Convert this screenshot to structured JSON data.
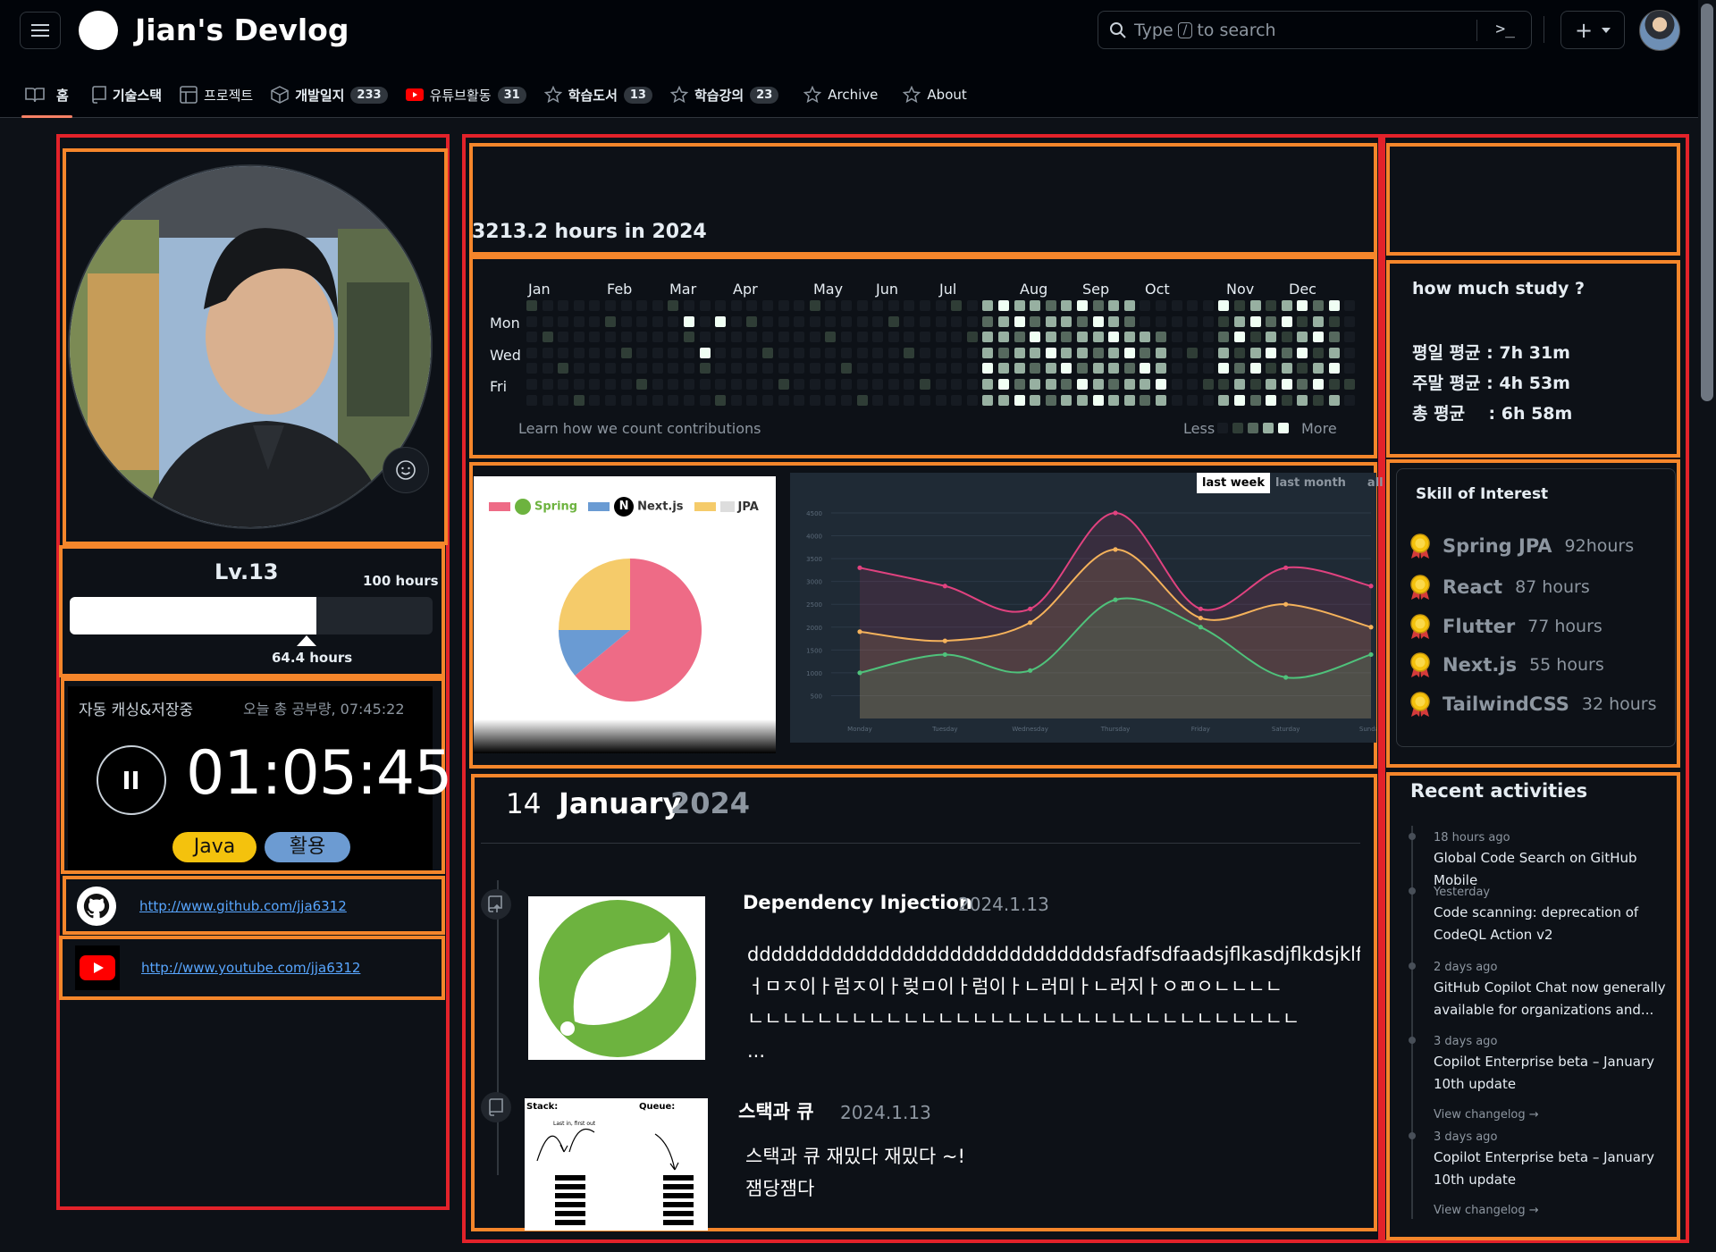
{
  "header": {
    "title": "Jian's Devlog",
    "search_pre": "Type",
    "search_key": "/",
    "search_post": "to search",
    "terminal_glyph": ">_",
    "plus": "+"
  },
  "nav": [
    {
      "label": "홈",
      "count": "",
      "icon": "book-icon",
      "active": true
    },
    {
      "label": "기술스택",
      "count": "",
      "icon": "repo-icon"
    },
    {
      "label": "프로젝트",
      "count": "",
      "icon": "table-icon"
    },
    {
      "label": "개발일지",
      "count": "233",
      "icon": "package-icon"
    },
    {
      "label": "유튜브활동",
      "count": "31",
      "icon": "youtube-icon"
    },
    {
      "label": "학습도서",
      "count": "13",
      "icon": "star-icon"
    },
    {
      "label": "학습강의",
      "count": "23",
      "icon": "star-icon"
    },
    {
      "label": "Archive",
      "count": "",
      "icon": "star-icon"
    },
    {
      "label": "About",
      "count": "",
      "icon": "star-icon"
    }
  ],
  "profile": {
    "level": "Lv.13",
    "goal": "100 hours",
    "current": "64.4 hours",
    "progress": 0.644
  },
  "timer": {
    "status": "자동 캐싱&저장중",
    "total": "오늘 총 공부량, 07:45:22",
    "time": "01:05:45",
    "tags": [
      "Java",
      "활용"
    ]
  },
  "links": {
    "github": "http://www.github.com/jja6312",
    "youtube": "http://www.youtube.com/jja6312"
  },
  "contrib": {
    "title": "3213.2 hours in 2024",
    "months": [
      "Jan",
      "Feb",
      "Mar",
      "Apr",
      "May",
      "Jun",
      "Jul",
      "Aug",
      "Sep",
      "Oct",
      "Nov",
      "Dec"
    ],
    "days": [
      "Mon",
      "Wed",
      "Fri"
    ],
    "learn": "Learn how we count contributions",
    "less": "Less",
    "more": "More",
    "colors": [
      "#161b22",
      "#2f3d36",
      "#56695e",
      "#97b0a1",
      "#f0fff4"
    ]
  },
  "pie_chart": {
    "type": "pie",
    "labels": [
      "Spring",
      "Next.js",
      "JPA"
    ],
    "values": [
      64,
      11,
      25
    ],
    "colors": [
      "#ee6b86",
      "#6a9bd3",
      "#f5cb6a"
    ]
  },
  "chart_data": {
    "type": "area",
    "x": [
      "Monday",
      "Tuesday",
      "Wednesday",
      "Thursday",
      "Friday",
      "Saturday",
      "Sunday"
    ],
    "ylim": [
      0,
      4500
    ],
    "yticks": [
      500,
      1000,
      1500,
      2000,
      2500,
      3000,
      3500,
      4000,
      4500
    ],
    "series": [
      {
        "values": [
          3300,
          2900,
          2400,
          4500,
          2400,
          3300,
          2900
        ],
        "color": "#e0427f"
      },
      {
        "values": [
          1900,
          1700,
          2100,
          3700,
          2200,
          2500,
          2000
        ],
        "color": "#f5b25b"
      },
      {
        "values": [
          1000,
          1400,
          1050,
          2600,
          2000,
          900,
          1400
        ],
        "color": "#4fc27b"
      }
    ],
    "tabs": [
      "last week",
      "last month",
      "all"
    ],
    "active_tab": "last week"
  },
  "posts": {
    "day": "14",
    "month": "January",
    "year": "2024",
    "items": [
      {
        "title": "Dependency Injection",
        "date": "2024.1.13",
        "body": "ddddddddddddddddddddddddddddddsfadfsdfaadsjflkasdjflkdsjklfajsdf\nㅓㅁㅈ이ㅏ럼ㅈ이ㅏ렂ㅁ이ㅏ럼이ㅏㄴ러미ㅏㄴ러지ㅏㅇㄻㅇㄴㄴㄴㄴ\nㄴㄴㄴㄴㄴㄴㄴㄴㄴㄴㄴㄴㄴㄴㄴㄴㄴㄴㄴㄴㄴㄴㄴㄴㄴㄴㄴㄴㄴㄴㄴㄴ\n..."
      },
      {
        "title": "스택과 큐",
        "date": "2024.1.13",
        "body": "스택과 큐 재밌다 재밌다 ~!\n잼당잼다",
        "thumb_stack": "Stack:",
        "thumb_queue": "Queue:",
        "thumb_lifo": "Last in, first out"
      }
    ]
  },
  "study": {
    "title": "how much study ?",
    "weekday": "평일 평균 : 7h 31m",
    "weekend": "주말 평균 : 4h 53m",
    "total": "총 평균    : 6h 58m"
  },
  "skills": {
    "title": "Skill of Interest",
    "items": [
      {
        "name": "Spring JPA",
        "hours": "92hours"
      },
      {
        "name": "React",
        "hours": "87 hours"
      },
      {
        "name": "Flutter",
        "hours": "77 hours"
      },
      {
        "name": "Next.js",
        "hours": "55 hours"
      },
      {
        "name": "TailwindCSS",
        "hours": "32 hours"
      }
    ]
  },
  "activities": {
    "title": "Recent activities",
    "items": [
      {
        "time": "18 hours ago",
        "text": "Global Code Search on GitHub Mobile"
      },
      {
        "time": "Yesterday",
        "text": "Code scanning: deprecation of CodeQL Action v2"
      },
      {
        "time": "2 days ago",
        "text": "GitHub Copilot Chat now generally available for organizations and..."
      },
      {
        "time": "3 days ago",
        "text": "Copilot Enterprise beta – January 10th update"
      },
      {
        "time": "3 days ago",
        "text": "Copilot Enterprise beta – January 10th update"
      }
    ],
    "changelog": "View changelog →"
  }
}
